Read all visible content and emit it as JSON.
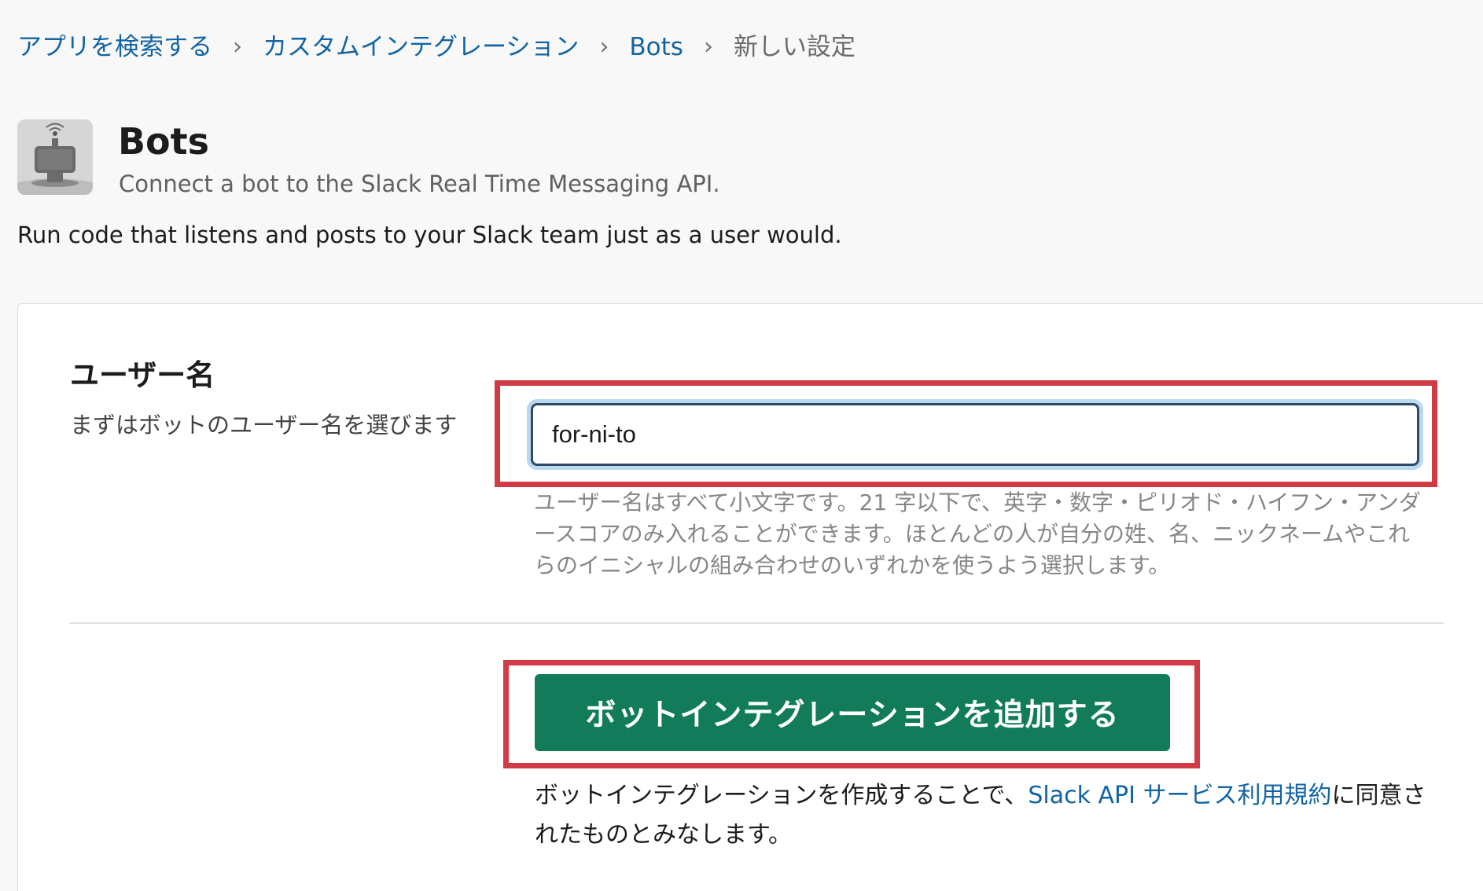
{
  "breadcrumb": {
    "items": [
      {
        "label": "アプリを検索する"
      },
      {
        "label": "カスタムインテグレーション"
      },
      {
        "label": "Bots"
      }
    ],
    "separator": "›",
    "current": "新しい設定"
  },
  "app": {
    "icon": "bot-icon",
    "title": "Bots",
    "subtitle": "Connect a bot to the Slack Real Time Messaging API.",
    "description": "Run code that listens and posts to your Slack team just as a user would."
  },
  "username_field": {
    "label": "ユーザー名",
    "help": "まずはボットのユーザー名を選びます",
    "value": "for-ni-to",
    "hint": "ユーザー名はすべて小文字です。21 字以下で、英字・数字・ピリオド・ハイフン・アンダースコアのみ入れることができます。ほとんどの人が自分の姓、名、ニックネームやこれらのイニシャルの組み合わせのいずれかを使うよう選択します。"
  },
  "actions": {
    "add_button": "ボットインテグレーションを追加する"
  },
  "terms": {
    "prefix": "ボットインテグレーションを作成することで、",
    "link": "Slack API サービス利用規約",
    "suffix": "に同意されたものとみなします。"
  },
  "colors": {
    "link": "#1264a3",
    "button": "#127c5a",
    "highlight": "#d13b45",
    "focus_ring": "#b9d9ee"
  }
}
